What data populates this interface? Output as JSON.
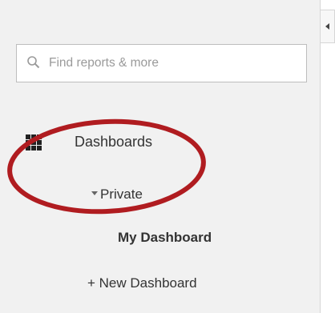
{
  "search": {
    "placeholder": "Find reports & more"
  },
  "nav": {
    "dashboards_label": "Dashboards",
    "dashboards_icon": "grid-icon",
    "private_label": "Private",
    "my_dashboard_label": "My Dashboard",
    "new_dashboard_label": "+ New Dashboard"
  },
  "colors": {
    "sidebar_bg": "#f1f1f1",
    "highlight_circle": "#b01c20",
    "text": "#333333"
  }
}
